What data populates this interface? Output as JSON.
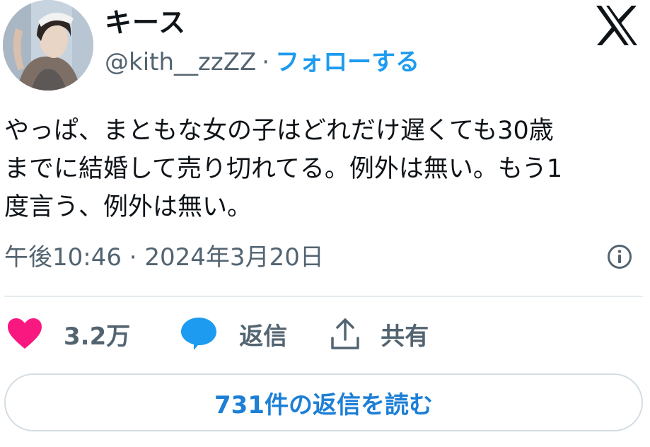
{
  "author": {
    "name": "キース",
    "handle": "@kith__zzZZ",
    "separator": "·",
    "follow_label": "フォローする"
  },
  "brand": {
    "logo": "x-logo-icon"
  },
  "tweet": {
    "text": "やっぱ、まともな女の子はどれだけ遅くても30歳\nまでに結婚して売り切れてる。例外は無い。もう1\n度言う、例外は無い。",
    "timestamp": "午後10:46 · 2024年3月20日"
  },
  "actions": {
    "like_count": "3.2万",
    "reply_label": "返信",
    "share_label": "共有"
  },
  "read_replies_label": "731件の返信を読む",
  "colors": {
    "accent": "#1d9bf0",
    "like": "#f91880",
    "muted": "#536471",
    "text": "#0f1419"
  }
}
